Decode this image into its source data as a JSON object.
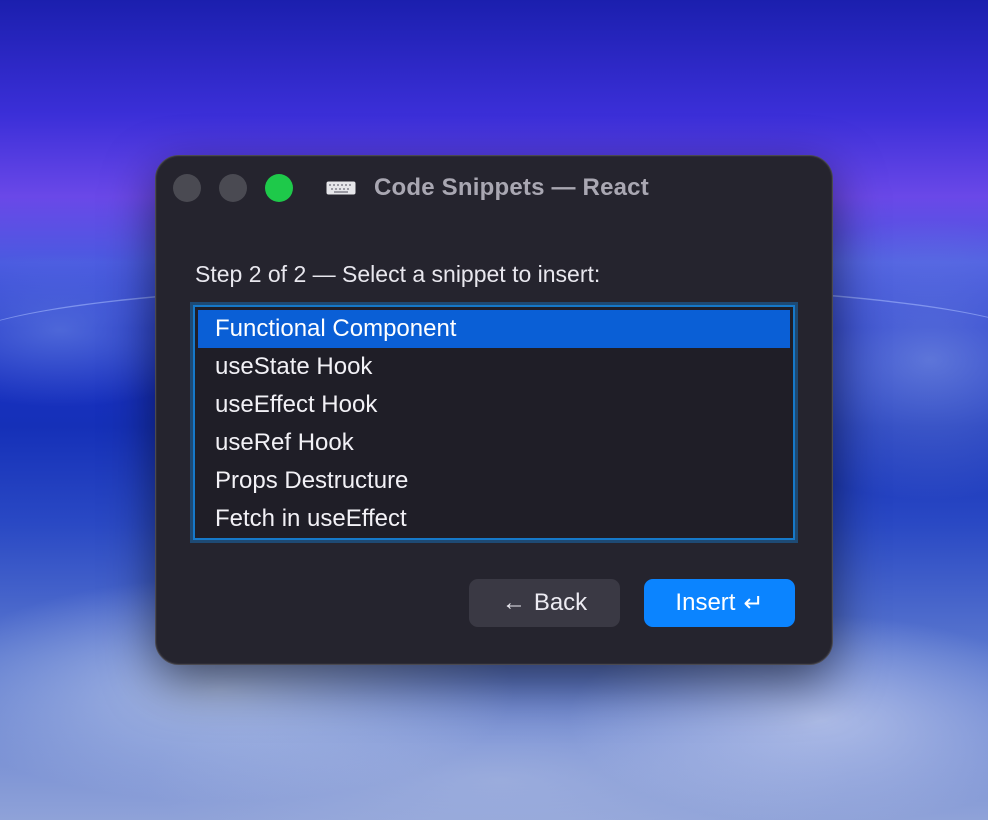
{
  "window": {
    "title": "Code Snippets — React",
    "title_icon": "keyboard-icon",
    "controls": [
      "close",
      "minimize",
      "zoom"
    ]
  },
  "dialog": {
    "prompt": "Step 2 of 2  —  Select a snippet to insert:",
    "snippets": [
      {
        "label": "Functional Component",
        "selected": true
      },
      {
        "label": "useState Hook",
        "selected": false
      },
      {
        "label": "useEffect Hook",
        "selected": false
      },
      {
        "label": "useRef Hook",
        "selected": false
      },
      {
        "label": "Props Destructure",
        "selected": false
      },
      {
        "label": "Fetch in useEffect",
        "selected": false
      }
    ]
  },
  "buttons": {
    "back": {
      "label": "Back",
      "icon": "arrow-left-icon",
      "glyph": "←"
    },
    "insert": {
      "label": "Insert",
      "icon": "return-icon",
      "glyph": "↵"
    }
  },
  "colors": {
    "accent": "#0b84ff",
    "selection": "#0a5fd6",
    "zoom_button": "#1ec94a",
    "window_bg": "#25242e"
  }
}
